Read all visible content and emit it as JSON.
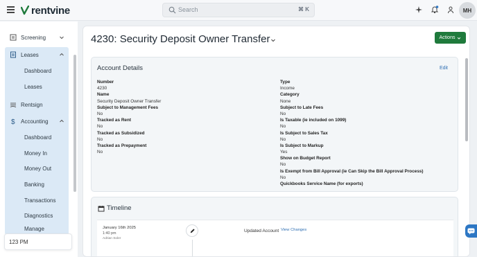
{
  "app": {
    "brand": "rentvine"
  },
  "topbar": {
    "search_placeholder": "Search",
    "search_shortcut": "⌘ K",
    "avatar_initials": "MH"
  },
  "sidebar": {
    "items": [
      {
        "label": "Screening",
        "icon": "screening-icon",
        "expanded": false
      },
      {
        "label": "Leases",
        "icon": "leases-icon",
        "expanded": true,
        "children": [
          "Dashboard",
          "Leases"
        ]
      },
      {
        "label": "Rentsign",
        "icon": "rentsign-icon"
      },
      {
        "label": "Accounting",
        "icon": "dollar-icon",
        "expanded": true,
        "children": [
          "Dashboard",
          "Money In",
          "Money Out",
          "Banking",
          "Transactions",
          "Diagnostics",
          "Manage"
        ]
      }
    ],
    "bottom_box": "123 PM"
  },
  "page": {
    "title": "4230: Security Deposit Owner Transfer",
    "actions_label": "Actions"
  },
  "account_details": {
    "heading": "Account Details",
    "edit_label": "Edit",
    "left_fields": [
      {
        "label": "Number",
        "value": "4230"
      },
      {
        "label": "Name",
        "value": "Security Deposit Owner Transfer"
      },
      {
        "label": "Subject to Management Fees",
        "value": "No"
      },
      {
        "label": "Tracked as Rent",
        "value": "No"
      },
      {
        "label": "Tracked as Subsidized",
        "value": "No"
      },
      {
        "label": "Tracked as Prepayment",
        "value": "No"
      }
    ],
    "right_fields": [
      {
        "label": "Type",
        "value": "Income"
      },
      {
        "label": "Category",
        "value": "None"
      },
      {
        "label": "Subject to Late Fees",
        "value": "No"
      },
      {
        "label": "Is Taxable (ie included on 1099)",
        "value": "No"
      },
      {
        "label": "Is Subject to Sales Tax",
        "value": "No"
      },
      {
        "label": "Is Subject to Markup",
        "value": "Yes"
      },
      {
        "label": "Show on Budget Report",
        "value": "No"
      },
      {
        "label": "Is Exempt from Bill Approval (ie Can Skip the Bill Approval Process)",
        "value": "No"
      },
      {
        "label": "Quickbooks Service Name (for exports)",
        "value": ""
      }
    ]
  },
  "timeline": {
    "heading": "Timeline",
    "entries": [
      {
        "date": "January 16th 2025",
        "time": "1:40 pm",
        "user": "Adrian Soler",
        "action": "Updated Account",
        "link": "View Changes"
      }
    ]
  },
  "colors": {
    "accent": "#1f7a3c",
    "link": "#2f6fb3",
    "nav_active_bg": "#dbe9f6"
  }
}
